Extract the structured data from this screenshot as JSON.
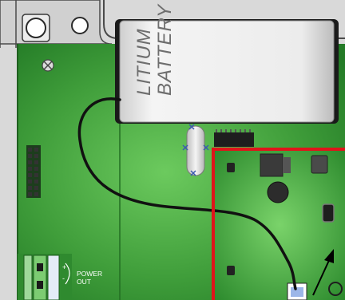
{
  "battery": {
    "line1": "LITIUM",
    "line2": "BATTERY"
  },
  "power_port": {
    "plus": "+",
    "minus": "-",
    "label_line1": "POWER",
    "label_line2": "OUT"
  },
  "colors": {
    "enclosure": "#d6d6d6",
    "board": "#2f8a2f",
    "board_light": "#5cbf52",
    "highlight_frame": "#e0141a",
    "battery": "#e9e9e9"
  },
  "icons": [
    "mounting-hole-icon",
    "screw-icon",
    "crystal-icon",
    "chip-icon",
    "arrow-icon"
  ]
}
